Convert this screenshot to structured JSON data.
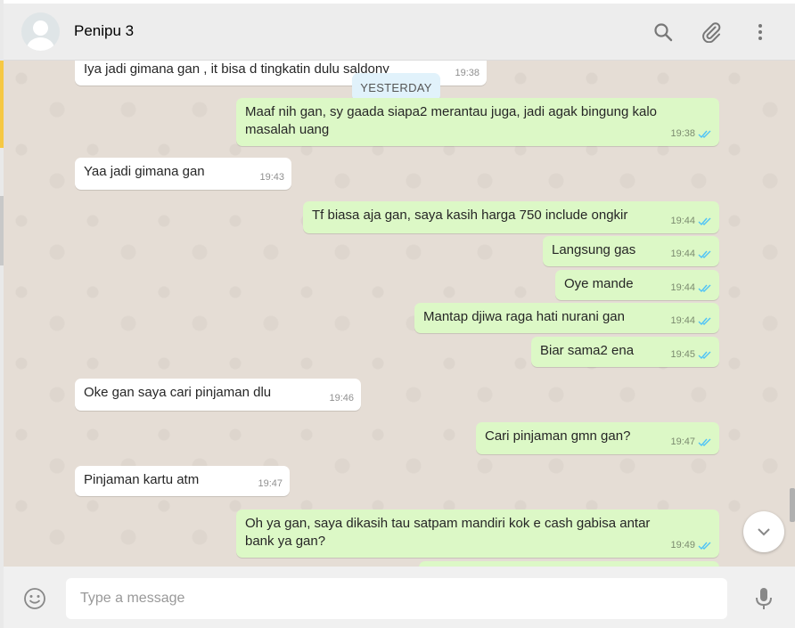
{
  "header": {
    "contact_name": "Penipu 3"
  },
  "date_chip": "YESTERDAY",
  "messages": [
    {
      "dir": "in",
      "text": "Iya jadi gimana gan , it bisa d tingkatin dulu saldony",
      "time": "19:38"
    },
    {
      "dir": "out",
      "text": "Maaf nih gan, sy gaada siapa2 merantau juga, jadi agak bingung kalo masalah uang",
      "time": "19:38"
    },
    {
      "dir": "in",
      "text": "Yaa jadi gimana gan",
      "time": "19:43"
    },
    {
      "dir": "out",
      "text": "Tf biasa aja gan, saya kasih harga 750 include ongkir",
      "time": "19:44"
    },
    {
      "dir": "out",
      "text": "Langsung gas",
      "time": "19:44"
    },
    {
      "dir": "out",
      "text": "Oye mande",
      "time": "19:44"
    },
    {
      "dir": "out",
      "text": "Mantap djiwa raga hati nurani gan",
      "time": "19:44"
    },
    {
      "dir": "out",
      "text": "Biar sama2 ena",
      "time": "19:45"
    },
    {
      "dir": "in",
      "text": "Oke gan saya cari pinjaman dlu",
      "time": "19:46"
    },
    {
      "dir": "out",
      "text": "Cari pinjaman gmn gan?",
      "time": "19:47"
    },
    {
      "dir": "in",
      "text": "Pinjaman kartu atm",
      "time": "19:47"
    },
    {
      "dir": "out",
      "text": "Oh ya gan, saya dikasih tau satpam mandiri kok e cash gabisa antar bank ya gan?",
      "time": "19:49"
    }
  ],
  "composer": {
    "placeholder": "Type a message",
    "value": ""
  },
  "icons": {
    "search": "search-icon",
    "attach": "paperclip-icon",
    "menu": "more-vertical-icon",
    "emoji": "emoji-icon",
    "mic": "microphone-icon",
    "scroll_down": "chevron-down-icon",
    "read": "double-check-icon"
  },
  "colors": {
    "incoming": "#ffffff",
    "outgoing": "#dcf8c6",
    "read_tick": "#4fc3f7",
    "background": "#e5ddd5"
  }
}
